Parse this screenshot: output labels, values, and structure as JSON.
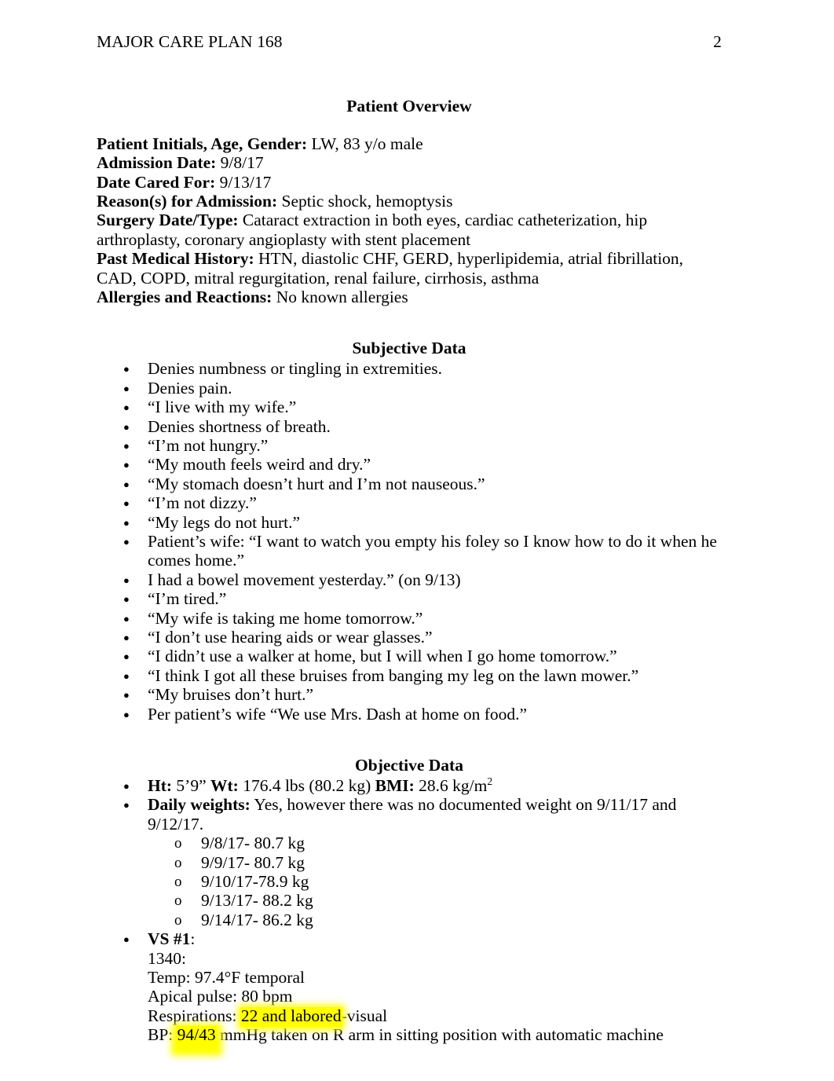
{
  "header": {
    "running_title": "MAJOR CARE PLAN 168",
    "page_number": "2"
  },
  "sections": {
    "patient_overview": {
      "heading": "Patient Overview",
      "fields": [
        {
          "label": "Patient Initials, Age, Gender:",
          "value": " LW, 83 y/o male"
        },
        {
          "label": "Admission Date:",
          "value": " 9/8/17"
        },
        {
          "label": "Date Cared For:",
          "value": " 9/13/17"
        },
        {
          "label": "Reason(s) for Admission:",
          "value": " Septic shock, hemoptysis"
        },
        {
          "label": "Surgery Date/Type:",
          "value": " Cataract extraction in both eyes, cardiac catheterization, hip arthroplasty, coronary angioplasty with stent placement"
        },
        {
          "label": "Past Medical History:",
          "value": " HTN, diastolic CHF, GERD, hyperlipidemia, atrial fibrillation, CAD, COPD, mitral regurgitation, renal failure, cirrhosis, asthma"
        },
        {
          "label": "Allergies and Reactions:",
          "value": " No known allergies"
        }
      ]
    },
    "subjective_data": {
      "heading": "Subjective Data",
      "items": [
        "Denies numbness or tingling in extremities.",
        "Denies pain.",
        "“I live with my wife.”",
        "Denies shortness of breath.",
        "“I’m not hungry.”",
        "“My mouth feels weird and dry.”",
        "“My stomach doesn’t hurt and I’m not nauseous.”",
        "“I’m not dizzy.”",
        "“My legs do not hurt.”",
        "Patient’s wife: “I want to watch you empty his foley so I know how to do it when he comes home.”",
        "I had a bowel movement yesterday.” (on 9/13)",
        "“I’m tired.”",
        "“My wife is taking me home tomorrow.”",
        "“I don’t use hearing aids or wear glasses.”",
        "“I didn’t use a walker at home, but I will when I go home tomorrow.”",
        "“I think I got all these bruises from banging my leg on the lawn mower.”",
        "“My bruises don’t hurt.”",
        "Per patient’s wife “We use Mrs. Dash at home on food.”"
      ]
    },
    "objective_data": {
      "heading": "Objective Data",
      "measurements": {
        "ht_label": "Ht:",
        "ht_value": " 5’9” ",
        "wt_label": "Wt:",
        "wt_value": " 176.4 lbs (80.2 kg) ",
        "bmi_label": "BMI:",
        "bmi_value": " 28.6 kg/m",
        "bmi_superscript": "2"
      },
      "daily_weights": {
        "label": "Daily weights:",
        "value": " Yes, however there was no documented weight on 9/11/17 and 9/12/17.",
        "entries": [
          "9/8/17- 80.7 kg",
          "9/9/17- 80.7 kg",
          "9/10/17-78.9 kg",
          "9/13/17- 88.2 kg",
          "9/14/17- 86.2 kg"
        ]
      },
      "vital_signs": {
        "label": "VS #1",
        "label_suffix": ":",
        "time": "1340:",
        "temp": "Temp: 97.4°F temporal",
        "apical_pulse": "Apical pulse: 80 bpm",
        "respirations_prefix": "Respirations: ",
        "respirations_highlight": "22 and labored",
        "respirations_suffix": "-visual",
        "bp_prefix": "BP: ",
        "bp_highlight": "94/43",
        "bp_suffix": " mmHg taken on R arm in sitting position with automatic machine"
      }
    }
  },
  "colors": {
    "highlight": "#ffff00",
    "text": "#000000",
    "page_background": "#ffffff"
  }
}
